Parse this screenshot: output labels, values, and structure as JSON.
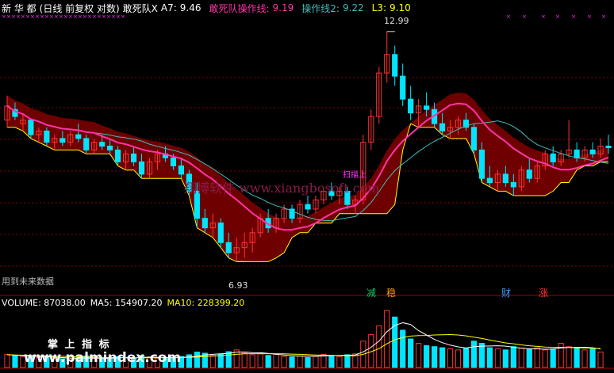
{
  "header": {
    "stock": "新 华 都",
    "period": "(日线 前复权 对数)",
    "indicator": "敢死队X",
    "a7_label": "A7:",
    "a7_value": "9.46",
    "gsd_label": "敢死队操作线:",
    "gsd_value": "9.19",
    "op2_label": "操作线2:",
    "op2_value": "9.22",
    "l3_label": "L3:",
    "l3_value": "9.10"
  },
  "annotations": {
    "high": "12.99",
    "low": "6.93",
    "future": "用到未来数据",
    "watermark1": "翔博软件 www.xiangbosoft.com",
    "watermark2": "www.palmindex.com",
    "watermark3": "掌 上 指 标",
    "partial": "扫描上"
  },
  "badges": [
    {
      "text": "减",
      "color": "#00cc66"
    },
    {
      "text": "稳",
      "color": "#ff9900"
    },
    {
      "text": "财",
      "color": "#3399ff"
    },
    {
      "text": "涨",
      "color": "#ff3333"
    }
  ],
  "volume": {
    "label": "VOLUME:",
    "value": "87038.00",
    "ma5_label": "MA5:",
    "ma5_value": "154907.20",
    "ma10_label": "MA10:",
    "ma10_value": "228399.20"
  },
  "colors": {
    "up": "#ff3333",
    "down": "#00e5ff",
    "band": "#7a0000",
    "band_edge": "#ffff00",
    "ma_pink": "#ff33aa",
    "ma_teal": "#44bbbb",
    "grid": "#8b0000",
    "marker": "#ff33ff"
  },
  "chart_data": {
    "type": "candlestick",
    "scale": "log",
    "ylim": [
      6.5,
      13.5
    ],
    "candles": [
      {
        "o": 10.2,
        "h": 10.9,
        "l": 10.0,
        "c": 10.6
      },
      {
        "o": 10.5,
        "h": 10.7,
        "l": 10.2,
        "c": 10.3
      },
      {
        "o": 10.1,
        "h": 10.4,
        "l": 9.9,
        "c": 10.2
      },
      {
        "o": 10.2,
        "h": 10.2,
        "l": 9.7,
        "c": 9.8
      },
      {
        "o": 9.8,
        "h": 10.0,
        "l": 9.6,
        "c": 9.9
      },
      {
        "o": 9.9,
        "h": 10.0,
        "l": 9.5,
        "c": 9.6
      },
      {
        "o": 9.6,
        "h": 9.8,
        "l": 9.4,
        "c": 9.7
      },
      {
        "o": 9.7,
        "h": 9.9,
        "l": 9.5,
        "c": 9.6
      },
      {
        "o": 9.6,
        "h": 9.9,
        "l": 9.5,
        "c": 9.8
      },
      {
        "o": 9.8,
        "h": 10.1,
        "l": 9.6,
        "c": 9.7
      },
      {
        "o": 9.7,
        "h": 9.8,
        "l": 9.3,
        "c": 9.4
      },
      {
        "o": 9.4,
        "h": 9.7,
        "l": 9.3,
        "c": 9.6
      },
      {
        "o": 9.6,
        "h": 9.8,
        "l": 9.4,
        "c": 9.5
      },
      {
        "o": 9.5,
        "h": 9.7,
        "l": 9.3,
        "c": 9.4
      },
      {
        "o": 9.4,
        "h": 9.5,
        "l": 9.0,
        "c": 9.1
      },
      {
        "o": 9.1,
        "h": 9.4,
        "l": 8.9,
        "c": 9.3
      },
      {
        "o": 9.3,
        "h": 9.5,
        "l": 9.0,
        "c": 9.1
      },
      {
        "o": 9.1,
        "h": 9.3,
        "l": 8.7,
        "c": 8.8
      },
      {
        "o": 8.8,
        "h": 9.2,
        "l": 8.7,
        "c": 9.1
      },
      {
        "o": 9.1,
        "h": 9.4,
        "l": 8.9,
        "c": 9.3
      },
      {
        "o": 9.3,
        "h": 9.5,
        "l": 9.1,
        "c": 9.2
      },
      {
        "o": 9.2,
        "h": 9.3,
        "l": 8.9,
        "c": 9.0
      },
      {
        "o": 9.0,
        "h": 9.2,
        "l": 8.7,
        "c": 8.8
      },
      {
        "o": 8.8,
        "h": 8.9,
        "l": 8.3,
        "c": 8.4
      },
      {
        "o": 8.4,
        "h": 8.6,
        "l": 7.6,
        "c": 7.8
      },
      {
        "o": 7.8,
        "h": 8.0,
        "l": 7.5,
        "c": 7.6
      },
      {
        "o": 7.6,
        "h": 7.9,
        "l": 7.4,
        "c": 7.7
      },
      {
        "o": 7.7,
        "h": 7.8,
        "l": 7.2,
        "c": 7.3
      },
      {
        "o": 7.3,
        "h": 7.5,
        "l": 7.0,
        "c": 7.1
      },
      {
        "o": 7.1,
        "h": 7.4,
        "l": 6.93,
        "c": 7.2
      },
      {
        "o": 7.2,
        "h": 7.5,
        "l": 7.0,
        "c": 7.3
      },
      {
        "o": 7.3,
        "h": 7.6,
        "l": 7.1,
        "c": 7.5
      },
      {
        "o": 7.5,
        "h": 7.9,
        "l": 7.4,
        "c": 7.8
      },
      {
        "o": 7.8,
        "h": 8.0,
        "l": 7.5,
        "c": 7.6
      },
      {
        "o": 7.6,
        "h": 7.9,
        "l": 7.5,
        "c": 7.8
      },
      {
        "o": 7.8,
        "h": 8.1,
        "l": 7.7,
        "c": 8.0
      },
      {
        "o": 8.0,
        "h": 8.1,
        "l": 7.7,
        "c": 7.8
      },
      {
        "o": 7.8,
        "h": 8.2,
        "l": 7.7,
        "c": 8.1
      },
      {
        "o": 8.1,
        "h": 8.3,
        "l": 7.9,
        "c": 8.0
      },
      {
        "o": 8.0,
        "h": 8.3,
        "l": 7.9,
        "c": 8.2
      },
      {
        "o": 8.2,
        "h": 8.5,
        "l": 8.1,
        "c": 8.4
      },
      {
        "o": 8.4,
        "h": 8.6,
        "l": 8.2,
        "c": 8.3
      },
      {
        "o": 8.3,
        "h": 8.5,
        "l": 8.1,
        "c": 8.4
      },
      {
        "o": 8.4,
        "h": 8.5,
        "l": 8.0,
        "c": 8.1
      },
      {
        "o": 8.1,
        "h": 8.3,
        "l": 7.9,
        "c": 8.2
      },
      {
        "o": 8.2,
        "h": 9.8,
        "l": 8.1,
        "c": 9.6
      },
      {
        "o": 9.6,
        "h": 10.5,
        "l": 9.4,
        "c": 10.3
      },
      {
        "o": 10.3,
        "h": 11.8,
        "l": 10.1,
        "c": 11.6
      },
      {
        "o": 11.6,
        "h": 12.99,
        "l": 11.3,
        "c": 12.2
      },
      {
        "o": 12.2,
        "h": 12.5,
        "l": 11.2,
        "c": 11.5
      },
      {
        "o": 11.5,
        "h": 11.9,
        "l": 10.6,
        "c": 10.8
      },
      {
        "o": 10.8,
        "h": 11.2,
        "l": 10.2,
        "c": 10.4
      },
      {
        "o": 10.4,
        "h": 10.8,
        "l": 10.0,
        "c": 10.6
      },
      {
        "o": 10.6,
        "h": 11.0,
        "l": 10.3,
        "c": 10.5
      },
      {
        "o": 10.5,
        "h": 10.7,
        "l": 10.0,
        "c": 10.1
      },
      {
        "o": 10.1,
        "h": 10.4,
        "l": 9.8,
        "c": 9.9
      },
      {
        "o": 9.9,
        "h": 10.2,
        "l": 9.7,
        "c": 10.0
      },
      {
        "o": 10.0,
        "h": 10.3,
        "l": 9.8,
        "c": 10.2
      },
      {
        "o": 10.2,
        "h": 10.4,
        "l": 9.9,
        "c": 10.0
      },
      {
        "o": 10.0,
        "h": 10.1,
        "l": 9.3,
        "c": 9.4
      },
      {
        "o": 9.4,
        "h": 9.6,
        "l": 8.6,
        "c": 8.7
      },
      {
        "o": 8.7,
        "h": 9.0,
        "l": 8.5,
        "c": 8.6
      },
      {
        "o": 8.6,
        "h": 8.9,
        "l": 8.4,
        "c": 8.8
      },
      {
        "o": 8.8,
        "h": 9.0,
        "l": 8.5,
        "c": 8.6
      },
      {
        "o": 8.6,
        "h": 8.8,
        "l": 8.3,
        "c": 8.5
      },
      {
        "o": 8.5,
        "h": 9.0,
        "l": 8.4,
        "c": 8.9
      },
      {
        "o": 8.9,
        "h": 9.2,
        "l": 8.6,
        "c": 8.7
      },
      {
        "o": 8.7,
        "h": 9.1,
        "l": 8.6,
        "c": 9.0
      },
      {
        "o": 9.0,
        "h": 9.4,
        "l": 8.9,
        "c": 9.3
      },
      {
        "o": 9.3,
        "h": 9.5,
        "l": 9.0,
        "c": 9.1
      },
      {
        "o": 9.1,
        "h": 9.4,
        "l": 9.0,
        "c": 9.3
      },
      {
        "o": 9.3,
        "h": 10.2,
        "l": 9.2,
        "c": 9.4
      },
      {
        "o": 9.4,
        "h": 9.6,
        "l": 9.1,
        "c": 9.2
      },
      {
        "o": 9.2,
        "h": 9.5,
        "l": 9.1,
        "c": 9.4
      },
      {
        "o": 9.4,
        "h": 9.6,
        "l": 9.2,
        "c": 9.3
      },
      {
        "o": 9.3,
        "h": 9.7,
        "l": 9.2,
        "c": 9.5
      },
      {
        "o": 9.5,
        "h": 9.8,
        "l": 9.3,
        "c": 9.46
      }
    ],
    "volumes": [
      60,
      55,
      50,
      48,
      45,
      50,
      42,
      40,
      38,
      44,
      52,
      40,
      38,
      42,
      50,
      45,
      40,
      55,
      48,
      42,
      40,
      44,
      50,
      58,
      70,
      65,
      55,
      60,
      72,
      80,
      66,
      58,
      62,
      55,
      60,
      50,
      48,
      52,
      45,
      50,
      60,
      55,
      50,
      58,
      62,
      120,
      150,
      190,
      260,
      230,
      170,
      130,
      110,
      100,
      95,
      90,
      85,
      80,
      88,
      120,
      110,
      90,
      85,
      80,
      95,
      88,
      82,
      90,
      80,
      85,
      110,
      95,
      88,
      80,
      85,
      70
    ],
    "ma5": [
      58,
      56,
      54,
      52,
      50,
      49,
      47,
      45,
      43,
      42,
      43,
      43,
      42,
      42,
      44,
      44,
      43,
      46,
      47,
      46,
      45,
      46,
      46,
      48,
      51,
      57,
      60,
      62,
      64,
      70,
      70,
      68,
      67,
      64,
      60,
      57,
      54,
      52,
      51,
      51,
      52,
      54,
      55,
      56,
      57,
      71,
      92,
      120,
      163,
      192,
      204,
      196,
      168,
      148,
      128,
      113,
      102,
      94,
      89,
      95,
      97,
      98,
      99,
      97,
      92,
      88,
      85,
      85,
      83,
      84,
      89,
      91,
      92,
      92,
      90,
      84
    ],
    "ma10": [
      58,
      57,
      56,
      55,
      54,
      53,
      52,
      51,
      50,
      49,
      48,
      47,
      46,
      45,
      45,
      45,
      44,
      44,
      44,
      44,
      44,
      44,
      45,
      46,
      48,
      50,
      52,
      54,
      57,
      60,
      62,
      63,
      63,
      63,
      63,
      62,
      61,
      60,
      58,
      57,
      56,
      55,
      54,
      53,
      53,
      60,
      72,
      86,
      108,
      126,
      137,
      143,
      145,
      146,
      148,
      149,
      150,
      148,
      144,
      138,
      132,
      125,
      118,
      112,
      108,
      103,
      99,
      96,
      93,
      92,
      92,
      91,
      90,
      89,
      88,
      86
    ]
  }
}
